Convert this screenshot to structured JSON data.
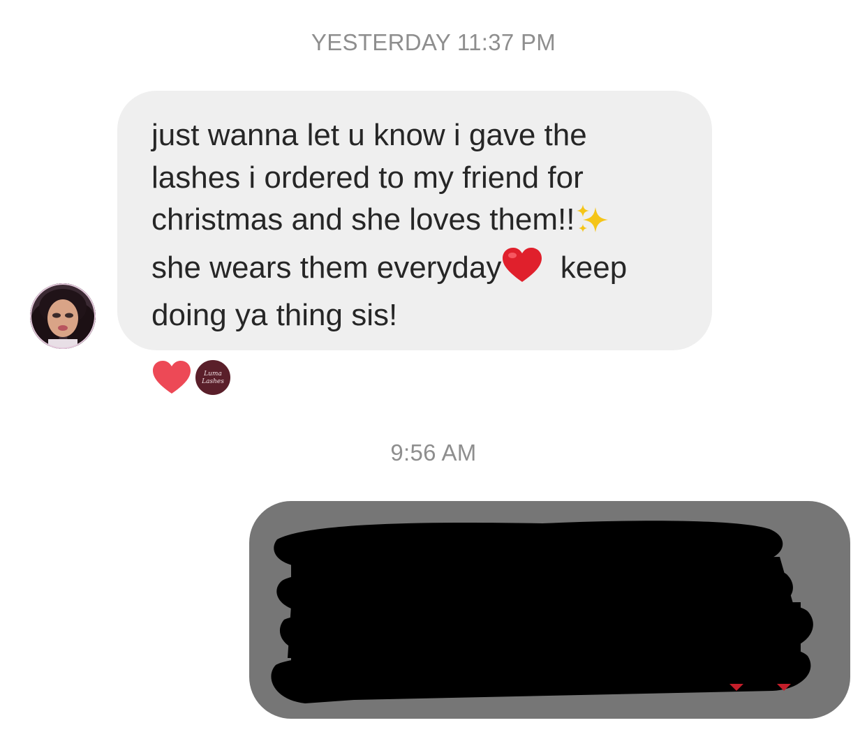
{
  "conversation": {
    "timestamp_1": "YESTERDAY 11:37 PM",
    "incoming_message": {
      "lines": [
        "just wanna let u know i gave the",
        "lashes i ordered to my friend for",
        "christmas and she loves them!!",
        "she wears them everyday",
        "keep",
        "doing ya thing sis!"
      ],
      "emojis": [
        "sparkles",
        "red-heart"
      ]
    },
    "reactions": {
      "emoji": "heart",
      "reactor_avatar_text": "Luma Lashes"
    },
    "timestamp_2": "9:56 AM",
    "outgoing_message": {
      "redacted": true
    }
  },
  "colors": {
    "incoming_bubble": "#efefef",
    "outgoing_bubble": "#767676",
    "timestamp_text": "#8e8e8e",
    "message_text": "#262626",
    "heart": "#ed4956",
    "redaction": "#000000"
  }
}
